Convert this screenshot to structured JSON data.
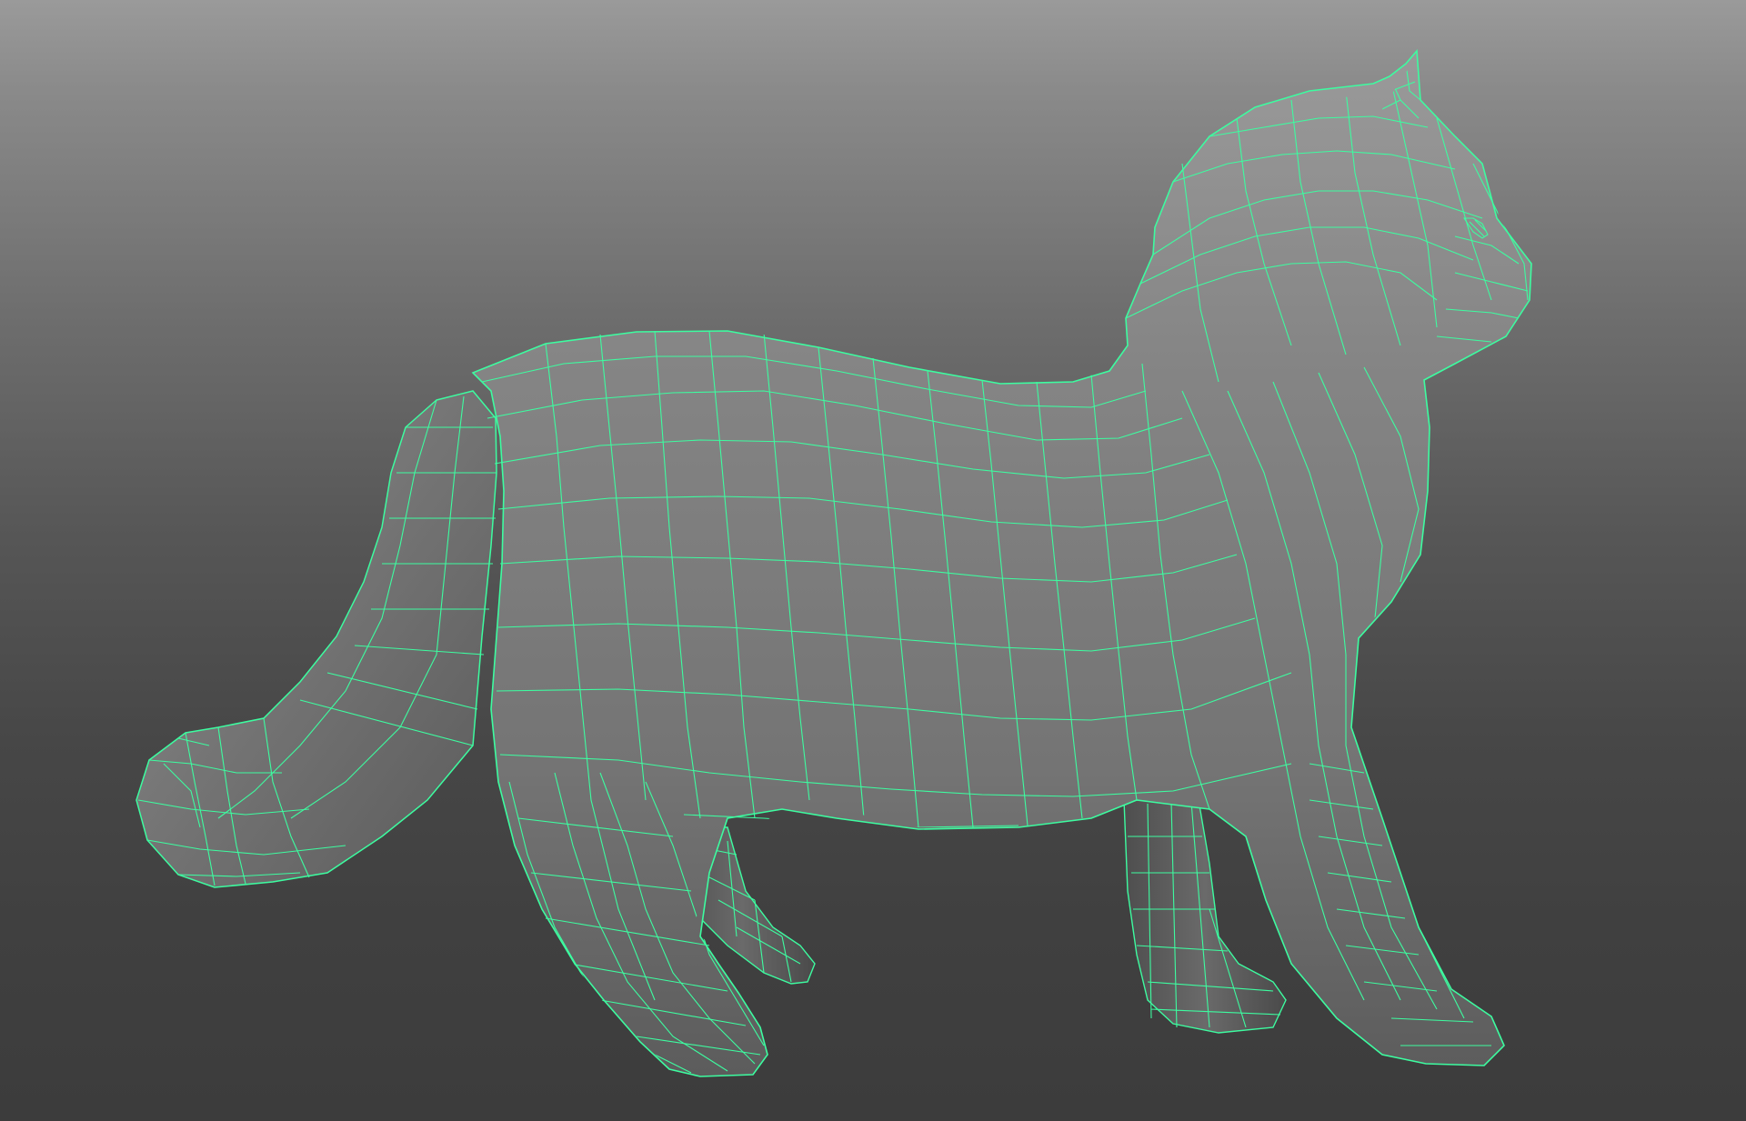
{
  "viewport": {
    "background_top": "#9a9a9a",
    "background_bottom": "#3c3c3c"
  },
  "model": {
    "object": "cat-mesh",
    "shading": "smooth-shaded-with-wireframe",
    "surface_color": "#7e7e7e",
    "wireframe_color": "#3dfca0"
  }
}
